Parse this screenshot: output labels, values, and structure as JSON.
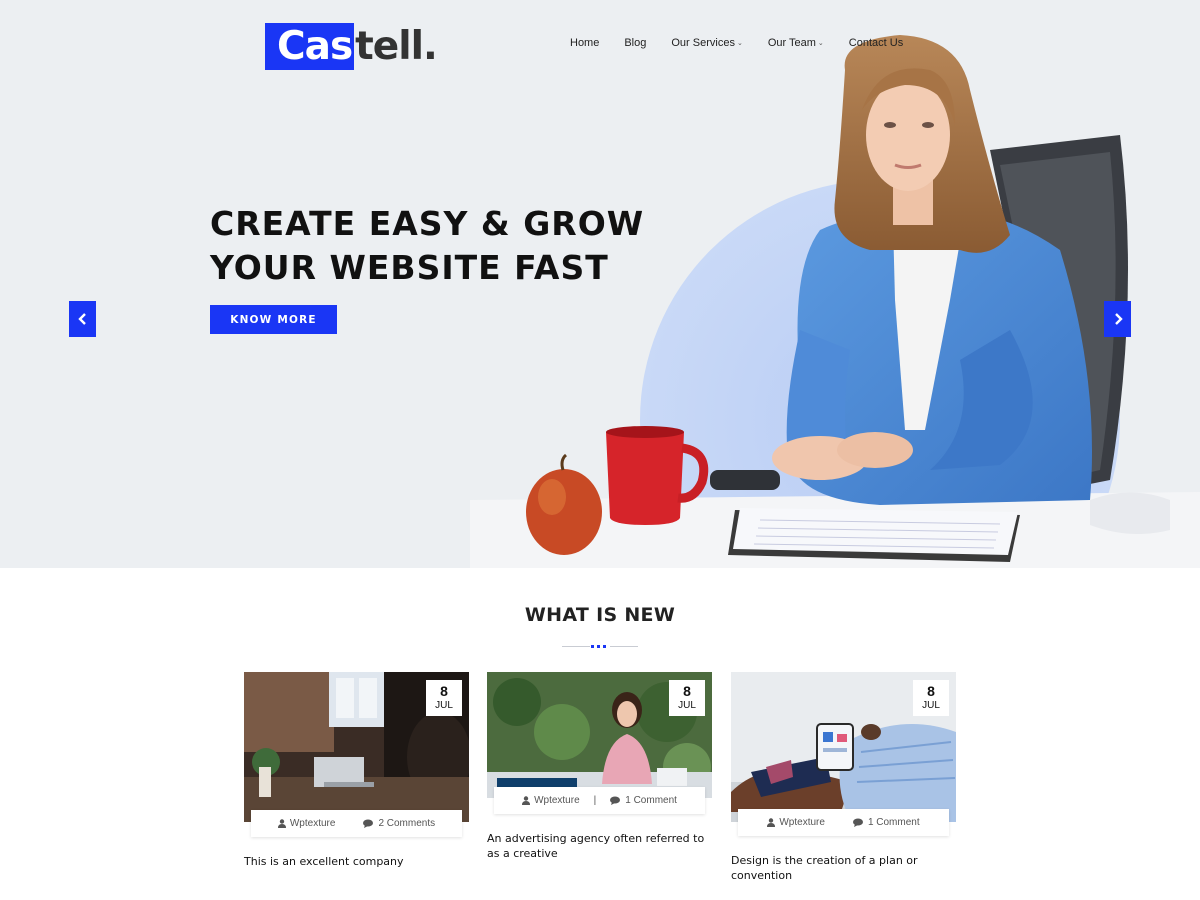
{
  "brand": {
    "logo_highlight": "Cas",
    "logo_rest": "tell.",
    "accent_color": "#1a36f5"
  },
  "nav": [
    {
      "label": "Home",
      "dropdown": false
    },
    {
      "label": "Blog",
      "dropdown": false
    },
    {
      "label": "Our Services",
      "dropdown": true
    },
    {
      "label": "Our Team",
      "dropdown": true
    },
    {
      "label": "Contact Us",
      "dropdown": false
    }
  ],
  "hero": {
    "title_line1": "CREATE EASY & GROW",
    "title_line2": "YOUR WEBSITE FAST",
    "button_label": "KNOW MORE",
    "prev_icon": "chevron-left-icon",
    "next_icon": "chevron-right-icon"
  },
  "section": {
    "title": "WHAT IS NEW"
  },
  "posts": [
    {
      "day": "8",
      "month": "JUL",
      "author": "Wptexture",
      "comments": "2 Comments",
      "title": "This is an excellent company"
    },
    {
      "day": "8",
      "month": "JUL",
      "author": "Wptexture",
      "comments": "1 Comment",
      "title": "An advertising agency often referred to as a creative"
    },
    {
      "day": "8",
      "month": "JUL",
      "author": "Wptexture",
      "comments": "1 Comment",
      "title": "Design is the creation of a plan or convention"
    }
  ]
}
